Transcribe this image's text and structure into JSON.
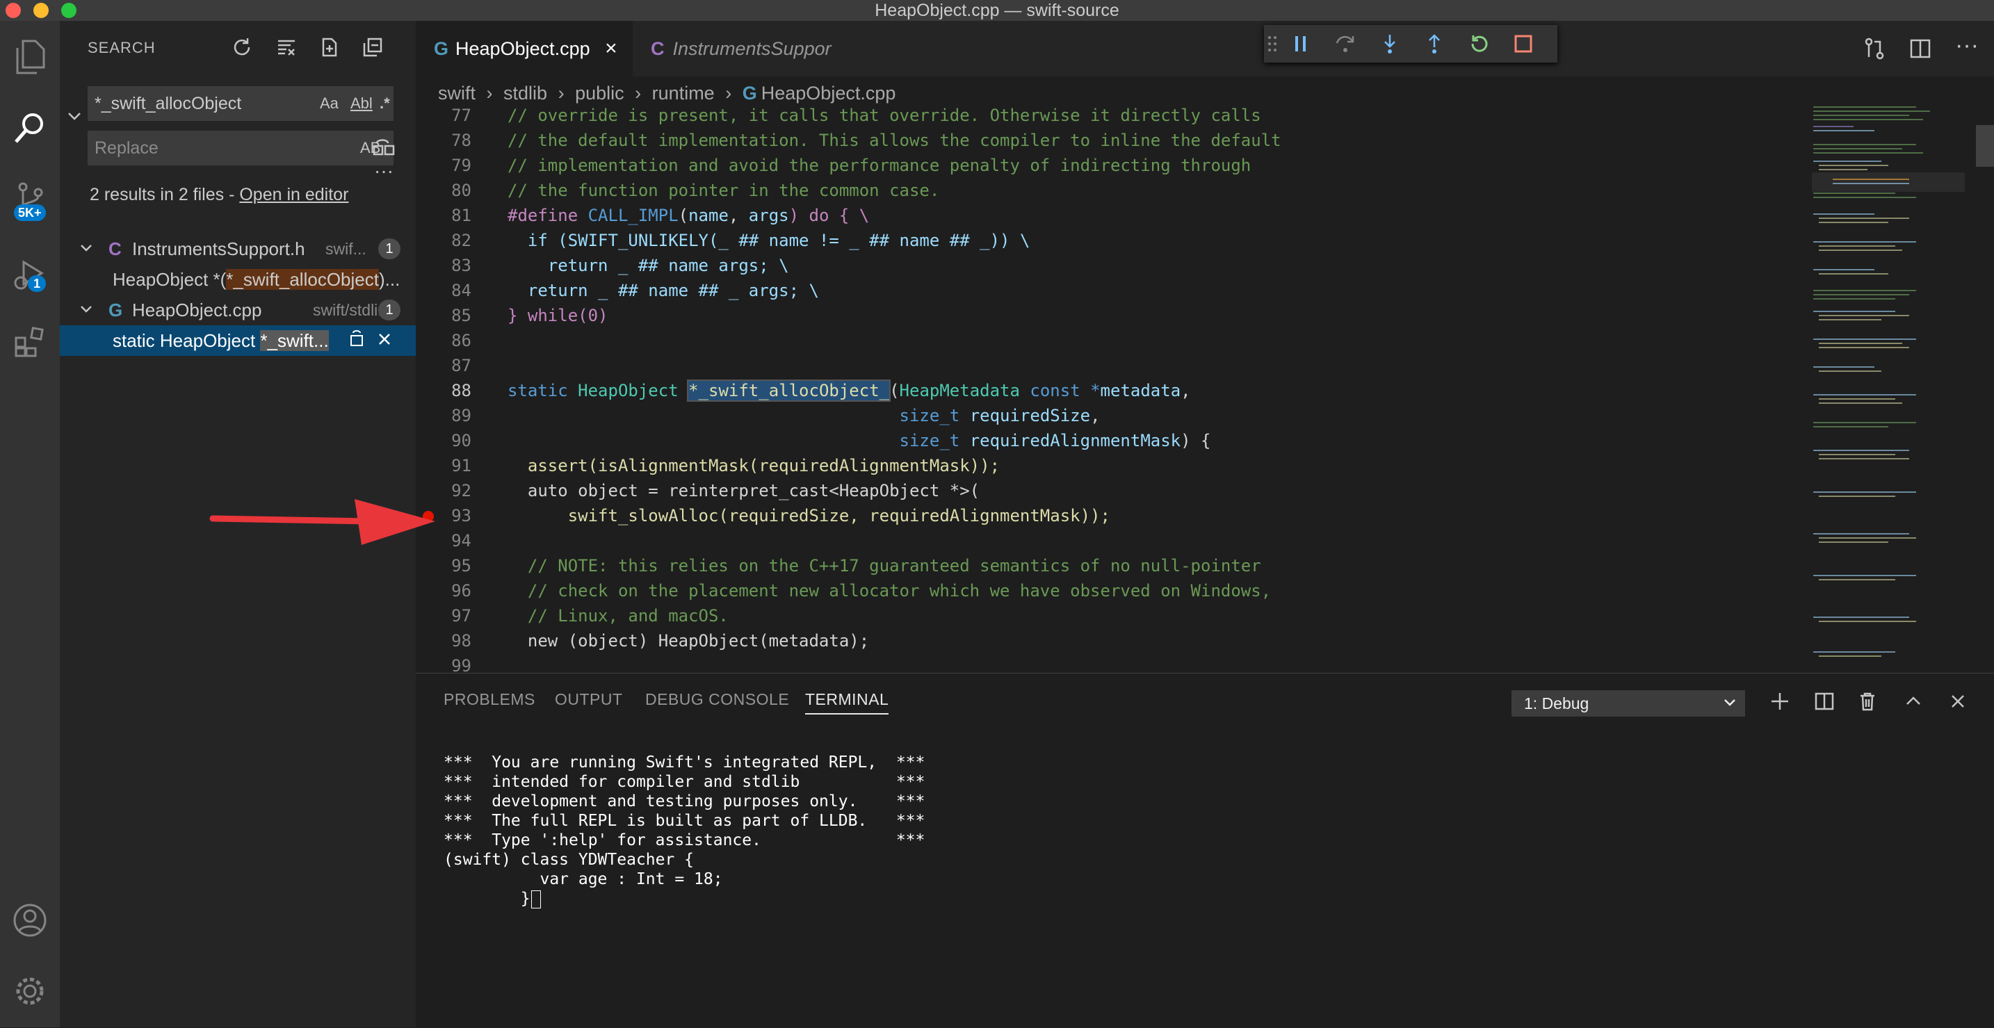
{
  "window": {
    "title": "HeapObject.cpp — swift-source"
  },
  "activity_bar": {
    "scm_badge": "5K+",
    "debug_badge": "1"
  },
  "search": {
    "title": "SEARCH",
    "query": "*_swift_allocObject",
    "match_case": "Aa",
    "whole_word": "Abl",
    "regex": ".*",
    "replace_placeholder": "Replace",
    "preserve_case": "AB",
    "results_prefix": "2 results in 2 files - ",
    "open_in_editor": "Open in editor",
    "files": [
      {
        "icon": "C",
        "name": "InstrumentsSupport.h",
        "path": "swif...",
        "count": "1",
        "match_prefix": "HeapObject *(",
        "match_hit": "*_swift_allocObject",
        "match_suffix": ")..."
      },
      {
        "icon": "G",
        "name": "HeapObject.cpp",
        "path": "swift/stdli...",
        "count": "1",
        "match_prefix": "static HeapObject ",
        "match_hit": "*_swift...",
        "match_suffix": ""
      }
    ]
  },
  "tabs": [
    {
      "label": "HeapObject.cpp",
      "close": "×"
    },
    {
      "label": "InstrumentsSuppor"
    }
  ],
  "breadcrumb": {
    "items": [
      "swift",
      "stdlib",
      "public",
      "runtime"
    ],
    "file": "HeapObject.cpp"
  },
  "editor": {
    "lines": [
      {
        "n": "77",
        "t": "// override is present, it calls that override. Otherwise it directly calls"
      },
      {
        "n": "78",
        "t": "// the default implementation. This allows the compiler to inline the default"
      },
      {
        "n": "79",
        "t": "// implementation and avoid the performance penalty of indirecting through"
      },
      {
        "n": "80",
        "t": "// the function pointer in the common case."
      },
      {
        "n": "81",
        "p": "#define ",
        "m": "CALL_IMPL",
        "a": "(",
        "b": "name",
        "c": ", ",
        "d": "args",
        "e": ") do { \\"
      },
      {
        "n": "82",
        "t": "  if (SWIFT_UNLIKELY(_ ## name != _ ## name ## _)) \\"
      },
      {
        "n": "83",
        "t": "    return _ ## name args; \\"
      },
      {
        "n": "84",
        "t": "  return _ ## name ## _ args; \\"
      },
      {
        "n": "85",
        "t": "} while(0)"
      },
      {
        "n": "86",
        "t": ""
      },
      {
        "n": "87",
        "t": ""
      },
      {
        "n": "88",
        "k": "static ",
        "ty": "HeapObject ",
        "sel": "*_swift_allocObject_",
        "r1": "(",
        "ty2": "HeapMetadata ",
        "k2": "const ",
        "op": "*",
        "v": "metadata",
        "end": ","
      },
      {
        "n": "89",
        "ind": "                                       ",
        "ty": "size_t ",
        "v": "requiredSize",
        "end": ","
      },
      {
        "n": "90",
        "ind": "                                       ",
        "ty": "size_t ",
        "v": "requiredAlignmentMask",
        "end": ") {"
      },
      {
        "n": "91",
        "t": "  assert(isAlignmentMask(requiredAlignmentMask));"
      },
      {
        "n": "92",
        "t": "  auto object = reinterpret_cast<HeapObject *>("
      },
      {
        "n": "93",
        "t": "      swift_slowAlloc(requiredSize, requiredAlignmentMask));"
      },
      {
        "n": "94",
        "t": ""
      },
      {
        "n": "95",
        "t": "  // NOTE: this relies on the C++17 guaranteed semantics of no null-pointer"
      },
      {
        "n": "96",
        "t": "  // check on the placement new allocator which we have observed on Windows,"
      },
      {
        "n": "97",
        "t": "  // Linux, and macOS."
      },
      {
        "n": "98",
        "t": "  new (object) HeapObject(metadata);"
      },
      {
        "n": "99",
        "t": ""
      }
    ]
  },
  "panel": {
    "tabs": [
      "PROBLEMS",
      "OUTPUT",
      "DEBUG CONSOLE",
      "TERMINAL"
    ],
    "active_tab": "TERMINAL",
    "terminal_select": "1: Debug",
    "terminal_lines": [
      "***  You are running Swift's integrated REPL,  ***",
      "***  intended for compiler and stdlib          ***",
      "***  development and testing purposes only.    ***",
      "***  The full REPL is built as part of LLDB.   ***",
      "***  Type ':help' for assistance.              ***",
      "(swift) class YDWTeacher {",
      "          var age : Int = 18;",
      "        }"
    ]
  },
  "colors": {
    "accent": "#007acc",
    "breakpoint": "#e51400",
    "annotation_arrow": "#e8363b",
    "match_highlight": "#613214"
  }
}
